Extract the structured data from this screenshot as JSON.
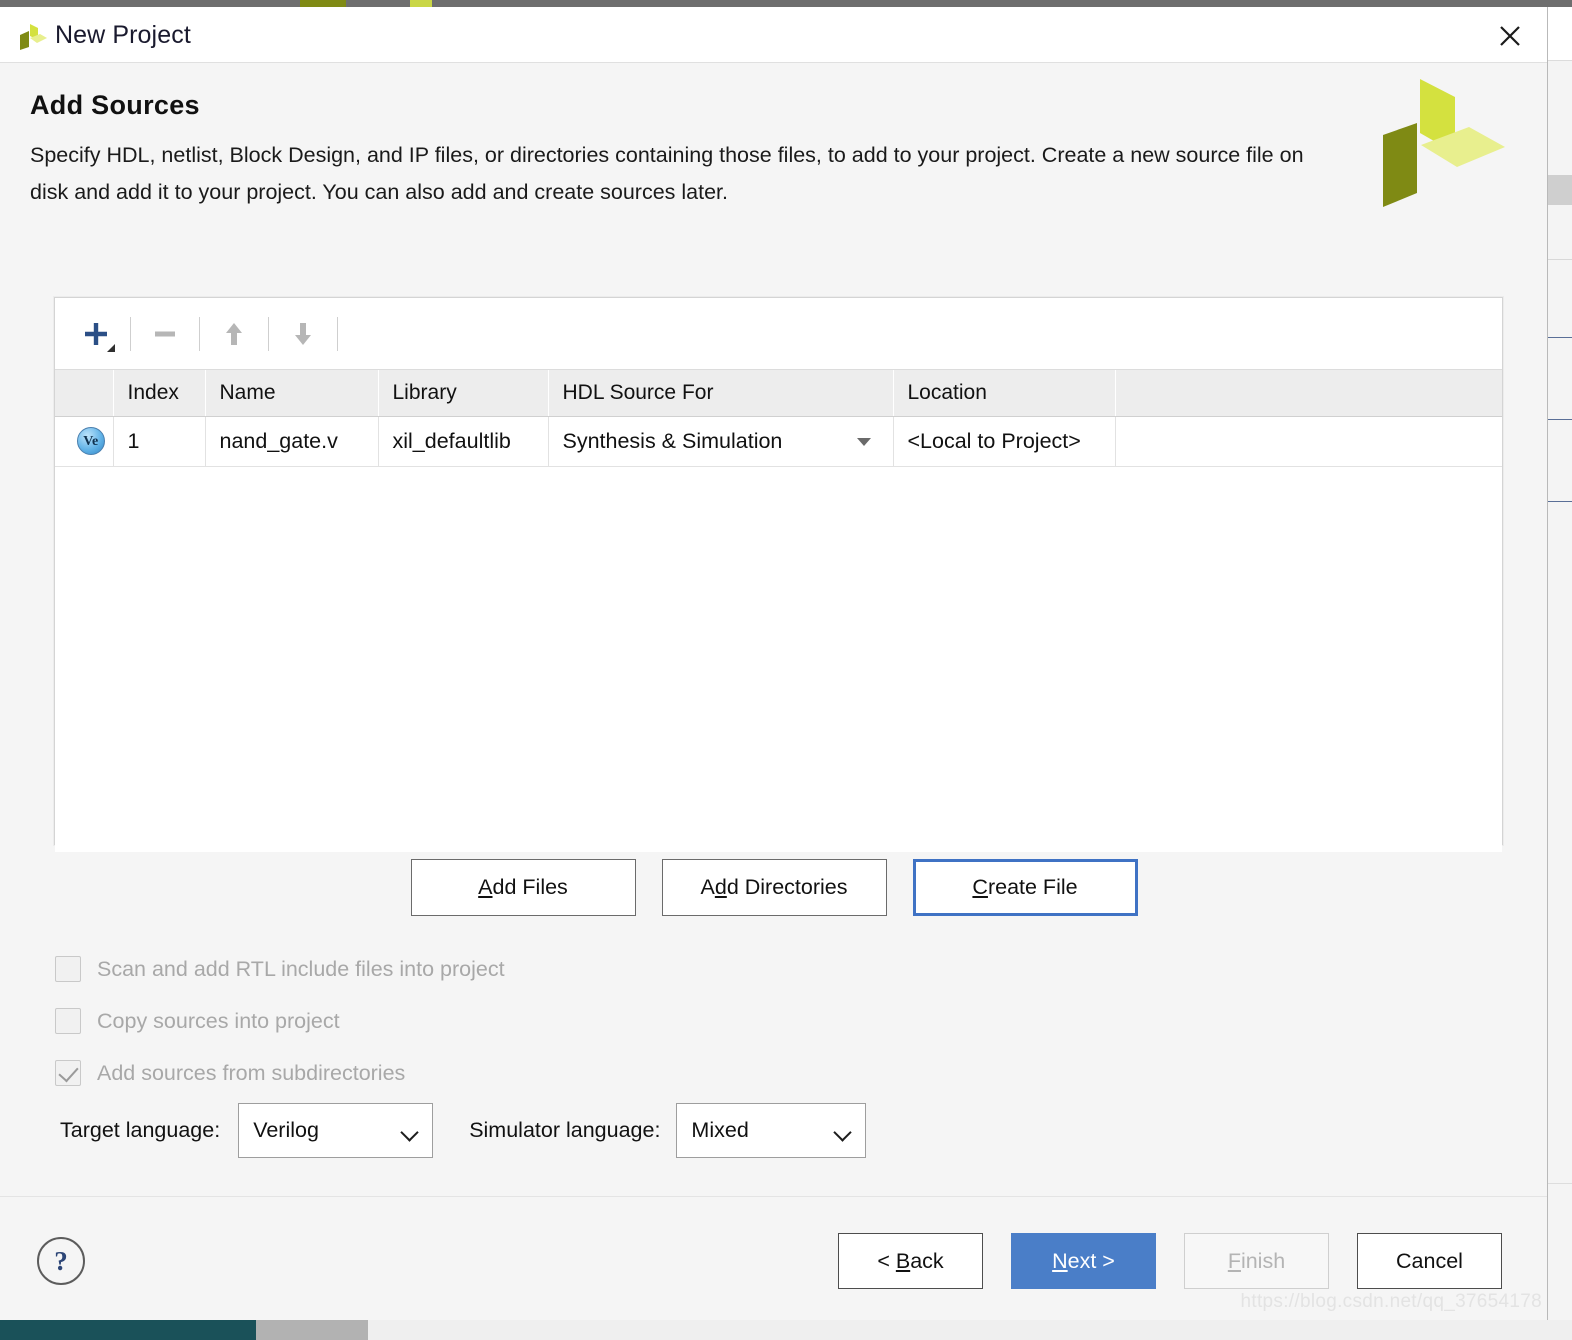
{
  "window": {
    "title": "New Project",
    "close_icon": "close-icon",
    "app_logo_icon": "xilinx-logo-icon"
  },
  "header": {
    "title": "Add Sources",
    "description": "Specify HDL, netlist, Block Design, and IP files, or directories containing those files, to add to your project. Create a new source file on disk and add it to your project. You can also add and create sources later.",
    "corner_logo_icon": "xilinx-logo-icon"
  },
  "toolbar": {
    "add_icon": "plus-icon",
    "add_dropdown_icon": "dropdown-triangle-icon",
    "remove_icon": "minus-icon",
    "move_up_icon": "arrow-up-icon",
    "move_down_icon": "arrow-down-icon"
  },
  "table": {
    "columns": [
      "",
      "Index",
      "Name",
      "Library",
      "HDL Source For",
      "Location",
      ""
    ],
    "rows": [
      {
        "type_icon": "verilog-file-icon",
        "type_icon_label": "Ve",
        "index": "1",
        "name": "nand_gate.v",
        "library": "xil_defaultlib",
        "hdl_source_for": "Synthesis & Simulation",
        "location": "<Local to Project>"
      }
    ]
  },
  "mid_buttons": [
    {
      "label": "Add Files",
      "mnemonic": "A",
      "focused": false
    },
    {
      "label": "Add Directories",
      "mnemonic": "d",
      "focused": false
    },
    {
      "label": "Create File",
      "mnemonic": "C",
      "focused": true
    }
  ],
  "checkboxes": [
    {
      "label": "Scan and add RTL include files into project",
      "checked": false,
      "disabled": true
    },
    {
      "label": "Copy sources into project",
      "checked": false,
      "disabled": true
    },
    {
      "label": "Add sources from subdirectories",
      "checked": true,
      "disabled": true
    }
  ],
  "languages": {
    "target_label": "Target language:",
    "target_value": "Verilog",
    "simulator_label": "Simulator language:",
    "simulator_value": "Mixed",
    "chevron_icon": "chevron-down-icon"
  },
  "footer": {
    "help_icon": "help-question-icon",
    "help_glyph": "?",
    "buttons": [
      {
        "label": "< Back",
        "style": "normal",
        "mnemonic": "B"
      },
      {
        "label": "Next >",
        "style": "primary",
        "mnemonic": "N"
      },
      {
        "label": "Finish",
        "style": "disabled",
        "mnemonic": "F"
      },
      {
        "label": "Cancel",
        "style": "normal",
        "mnemonic": ""
      }
    ]
  },
  "watermark": "https://blog.csdn.net/qq_37654178",
  "colors": {
    "primary_button": "#4a7ec8",
    "focus_border": "#3f72c4",
    "logo_dark": "#7f8a14",
    "logo_bright": "#d4e13f",
    "logo_pale": "#e8ef8e",
    "taskbar_teal": "#1a5159"
  }
}
